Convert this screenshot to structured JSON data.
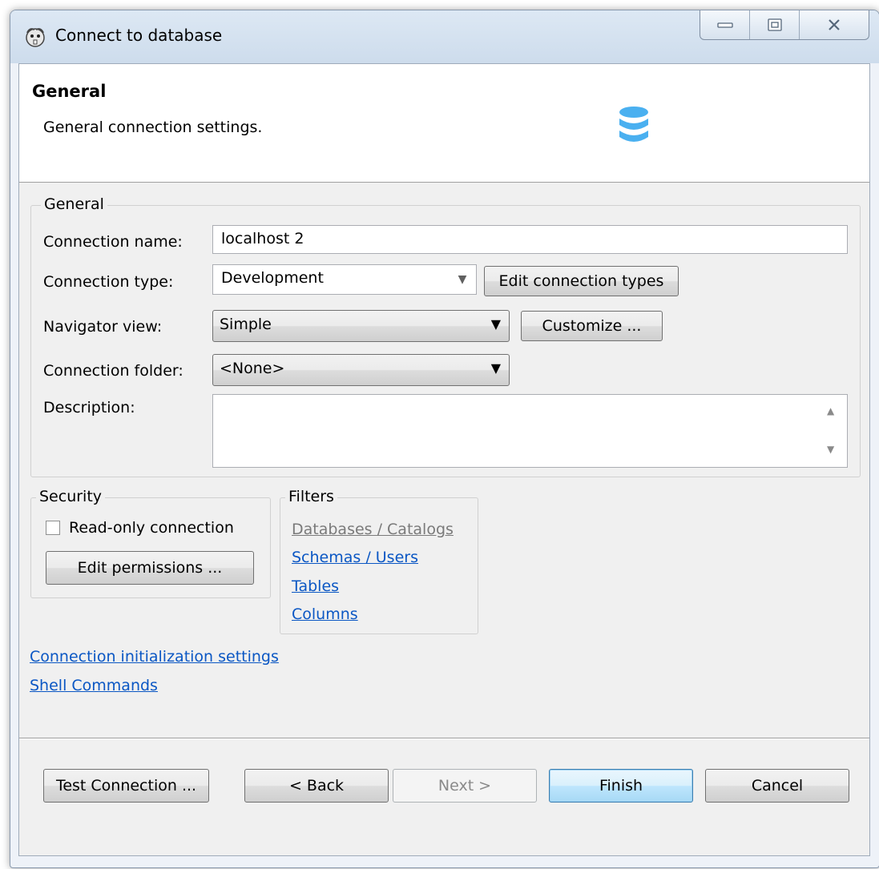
{
  "window": {
    "title": "Connect to database",
    "controls": {
      "minimize": "minimize-icon",
      "maximize": "maximize-icon",
      "close": "close-icon"
    }
  },
  "header": {
    "title": "General",
    "description": "General connection settings.",
    "icon": "database-icon",
    "icon_color": "#4ab0f0"
  },
  "general_group": {
    "label": "General",
    "connection_name_label": "Connection name:",
    "connection_name_value": "localhost 2",
    "connection_type_label": "Connection type:",
    "connection_type_value": "Development",
    "edit_connection_types_button": "Edit connection types",
    "navigator_view_label": "Navigator view:",
    "navigator_view_value": "Simple",
    "customize_button": "Customize ...",
    "connection_folder_label": "Connection folder:",
    "connection_folder_value": "<None>",
    "description_label": "Description:",
    "description_value": ""
  },
  "security_group": {
    "label": "Security",
    "read_only_label": "Read-only connection",
    "read_only_checked": false,
    "edit_permissions_button": "Edit permissions ..."
  },
  "filters_group": {
    "label": "Filters",
    "items": [
      {
        "label": "Databases / Catalogs",
        "enabled": false
      },
      {
        "label": "Schemas / Users",
        "enabled": true
      },
      {
        "label": "Tables",
        "enabled": true
      },
      {
        "label": "Columns",
        "enabled": true
      }
    ]
  },
  "links": {
    "init_settings": "Connection initialization settings",
    "shell_commands": "Shell Commands"
  },
  "footer": {
    "test_connection": "Test Connection ...",
    "back": "< Back",
    "next": "Next >",
    "finish": "Finish",
    "cancel": "Cancel"
  },
  "colors": {
    "link": "#0b57c4",
    "disabled_text": "#8a8a8a",
    "default_button_border": "#3c7fb1"
  }
}
